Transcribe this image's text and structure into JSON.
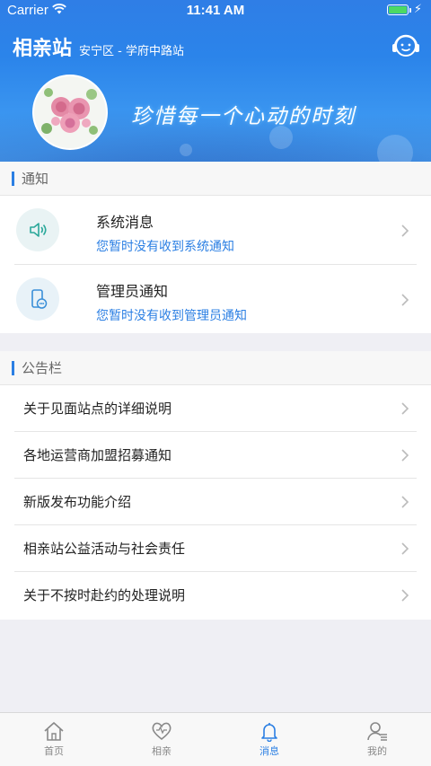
{
  "status_bar": {
    "carrier": "Carrier",
    "time": "11:41 AM"
  },
  "header": {
    "title": "相亲站",
    "subtitle": "安宁区 - 学府中路站",
    "slogan": "珍惜每一个心动的时刻",
    "service_icon": "customer-service-icon"
  },
  "notice": {
    "section_title": "通知",
    "items": [
      {
        "title": "系统消息",
        "subtitle": "您暂时没有收到系统通知",
        "icon": "speaker-icon"
      },
      {
        "title": "管理员通知",
        "subtitle": "您暂时没有收到管理员通知",
        "icon": "phone-chat-icon"
      }
    ]
  },
  "bulletin": {
    "section_title": "公告栏",
    "items": [
      "关于见面站点的详细说明",
      "各地运营商加盟招募通知",
      "新版发布功能介绍",
      "相亲站公益活动与社会责任",
      "关于不按时赴约的处理说明"
    ]
  },
  "tabbar": {
    "tabs": [
      {
        "label": "首页",
        "icon": "home-icon",
        "active": false
      },
      {
        "label": "相亲",
        "icon": "heart-icon",
        "active": false
      },
      {
        "label": "消息",
        "icon": "bell-icon",
        "active": true
      },
      {
        "label": "我的",
        "icon": "profile-icon",
        "active": false
      }
    ]
  },
  "colors": {
    "accent": "#2b7fe3",
    "header": "#2f7ee6",
    "battery": "#4cd964"
  }
}
